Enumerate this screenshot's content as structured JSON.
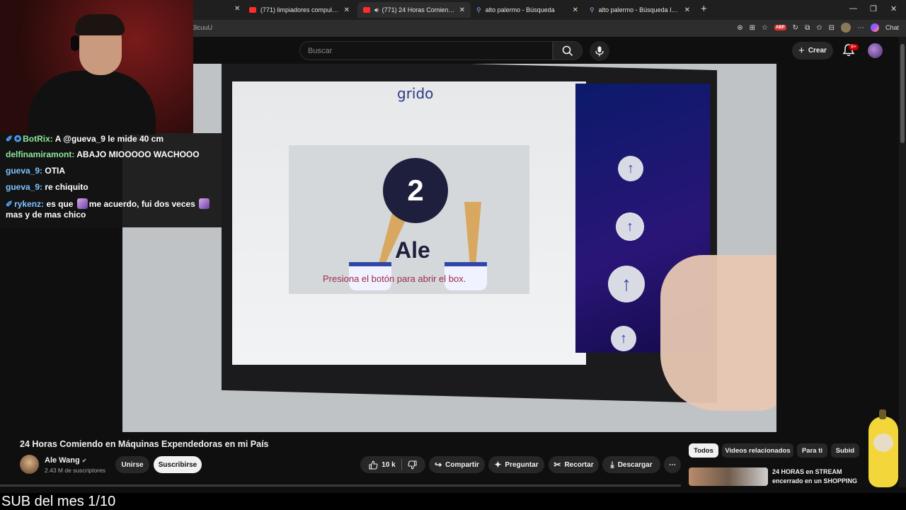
{
  "tabs": [
    {
      "title": "(771) limpiadores compulsivos - Y",
      "favicon": "youtube-icon",
      "active": false
    },
    {
      "title": "(771) 24 Horas Comiendo en M",
      "favicon": "youtube-icon",
      "active": true
    },
    {
      "title": "alto palermo - Búsqueda",
      "favicon": "search-icon",
      "active": false
    },
    {
      "title": "alto palermo - Búsqueda Imágenes",
      "favicon": "search-icon",
      "active": false
    }
  ],
  "browser": {
    "url_fragment": "3lcuuU",
    "chat_label": "Chat",
    "abp_label": "ABP"
  },
  "youtube": {
    "search_placeholder": "Buscar",
    "create_label": "Crear",
    "notif_badge": "9+"
  },
  "video_overlay": {
    "logo": "grido",
    "number": "2",
    "name": "Ale",
    "subtitle": "Presiona el botón para abrir el box."
  },
  "chat": [
    {
      "user": "BotRix",
      "message": "A @gueva_9 le mide 40 cm",
      "badge": true,
      "user_color": "#8ce99a"
    },
    {
      "user": "delfinamiramont",
      "message": "ABAJO MIOOOOO WACHOOO",
      "badge": false,
      "user_color": "#8ce99a"
    },
    {
      "user": "gueva_9",
      "message": "OTIA",
      "badge": false,
      "user_color": "#7cc4ff"
    },
    {
      "user": "gueva_9",
      "message": "re chiquito",
      "badge": false,
      "user_color": "#7cc4ff"
    },
    {
      "user": "rykenz",
      "message_parts": [
        "es que",
        "me acuerdo, fui dos veces",
        "mas y de mas chico"
      ],
      "badge": true,
      "user_color": "#7cc4ff"
    }
  ],
  "video_info": {
    "title": "24 Horas Comiendo en Máquinas Expendedoras en mi País",
    "channel": "Ale Wang",
    "subscribers": "2.43 M de suscriptores",
    "join_label": "Unirse",
    "subscribe_label": "Suscribirse",
    "likes": "10 k",
    "share_label": "Compartir",
    "ask_label": "Preguntar",
    "clip_label": "Recortar",
    "download_label": "Descargar"
  },
  "chips": [
    {
      "label": "Todos",
      "active": true
    },
    {
      "label": "Videos relacionados",
      "active": false
    },
    {
      "label": "Para ti",
      "active": false
    },
    {
      "label": "Subid",
      "active": false
    }
  ],
  "related": {
    "title": "24 HORAS en STREAM encerrado en un SHOPPING"
  },
  "caption": "SUB del mes 1/10"
}
